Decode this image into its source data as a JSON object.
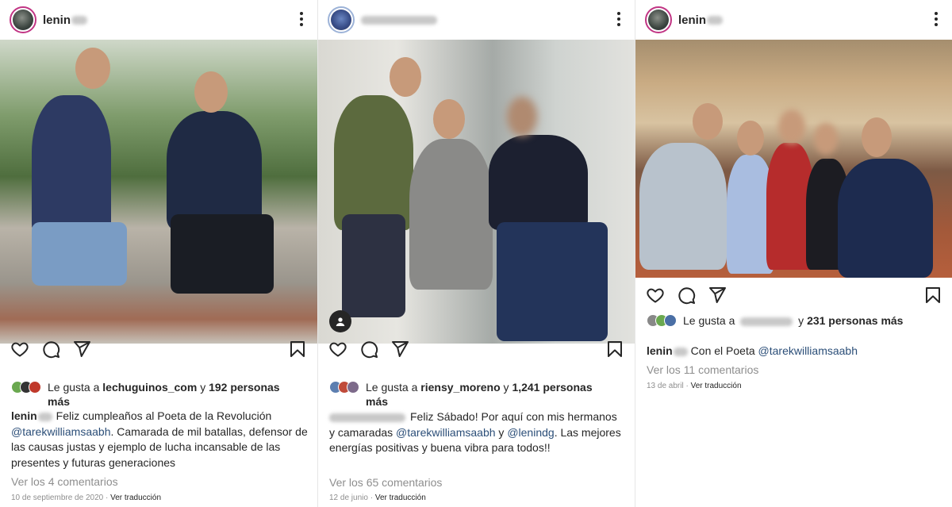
{
  "posts": [
    {
      "username": "lenin",
      "likes": {
        "prefix": "Le gusta a",
        "user": "lechuguinos_com",
        "joiner": "y",
        "count": "192 personas",
        "suffix": "más"
      },
      "caption": {
        "username": "lenin",
        "text1": "Feliz cumpleaños al Poeta de la Revolución",
        "mention": "@tarekwilliamsaabh",
        "text2": ". Camarada de mil batallas, defensor de las causas justas y ejemplo de lucha incansable de las presentes y futuras generaciones"
      },
      "comments": "Ver los 4 comentarios",
      "date": "10 de septiembre de 2020",
      "translate": "Ver traducción"
    },
    {
      "username": "",
      "likes": {
        "prefix": "Le gusta a",
        "user": "riensy_moreno",
        "joiner": "y",
        "count": "1,241 personas",
        "suffix": "más"
      },
      "caption": {
        "username": "",
        "text1": "Feliz Sábado! Por aquí con mis hermanos y camaradas",
        "mention": "@tarekwilliamsaabh",
        "text2": "y",
        "mention2": "@lenindg",
        "text3": ". Las mejores energías positivas y buena vibra para todos!!"
      },
      "comments": "Ver los 65 comentarios",
      "date": "12 de junio",
      "translate": "Ver traducción"
    },
    {
      "username": "lenin",
      "likes": {
        "prefix": "Le gusta a",
        "user": "",
        "joiner": "y",
        "count": "231 personas más",
        "suffix": ""
      },
      "caption": {
        "username": "lenin",
        "text1": "Con el Poeta",
        "mention": "@tarekwilliamsaabh"
      },
      "comments": "Ver los 11 comentarios",
      "date": "13 de abril",
      "translate": "Ver traducción"
    }
  ],
  "colors": {
    "text": "#262626",
    "muted": "#8e8e8e",
    "mention": "#2b4e78",
    "story_ring": "#c13584"
  },
  "icons": [
    "more-options-icon",
    "heart-icon",
    "comment-icon",
    "share-icon",
    "bookmark-icon",
    "tagged-user-icon"
  ]
}
